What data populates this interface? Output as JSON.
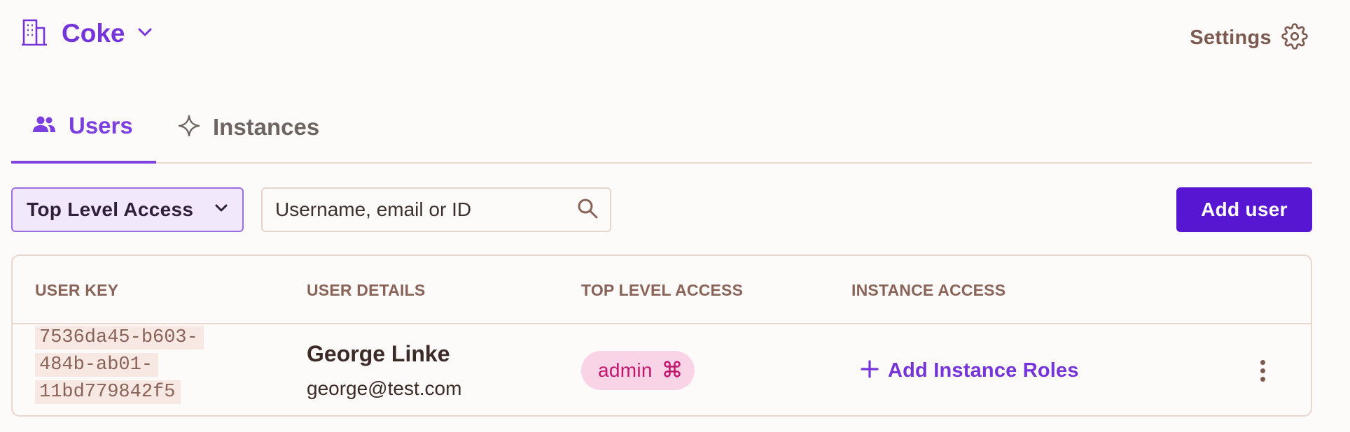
{
  "header": {
    "tenant_name": "Coke",
    "tenant_icon": "building-icon",
    "settings_label": "Settings",
    "settings_icon": "gear-icon"
  },
  "tabs": [
    {
      "label": "Users",
      "icon": "users-icon",
      "active": true
    },
    {
      "label": "Instances",
      "icon": "sparkle-icon",
      "active": false
    }
  ],
  "toolbar": {
    "filter_label": "Top Level Access",
    "search_placeholder": "Username, email or ID",
    "search_value": "",
    "add_user_label": "Add user"
  },
  "table": {
    "columns": [
      "USER KEY",
      "USER DETAILS",
      "TOP LEVEL ACCESS",
      "INSTANCE ACCESS"
    ],
    "rows": [
      {
        "user_key_lines": [
          "7536da45-b603-",
          "484b-ab01-",
          "11bd779842f5"
        ],
        "name": "George Linke",
        "email": "george@test.com",
        "role": "admin",
        "add_roles_label": "Add Instance Roles"
      }
    ]
  },
  "colors": {
    "accent": "#7434d8",
    "primary_button": "#5716d2",
    "badge_bg": "#f9d4e6",
    "badge_text": "#c0186f"
  }
}
